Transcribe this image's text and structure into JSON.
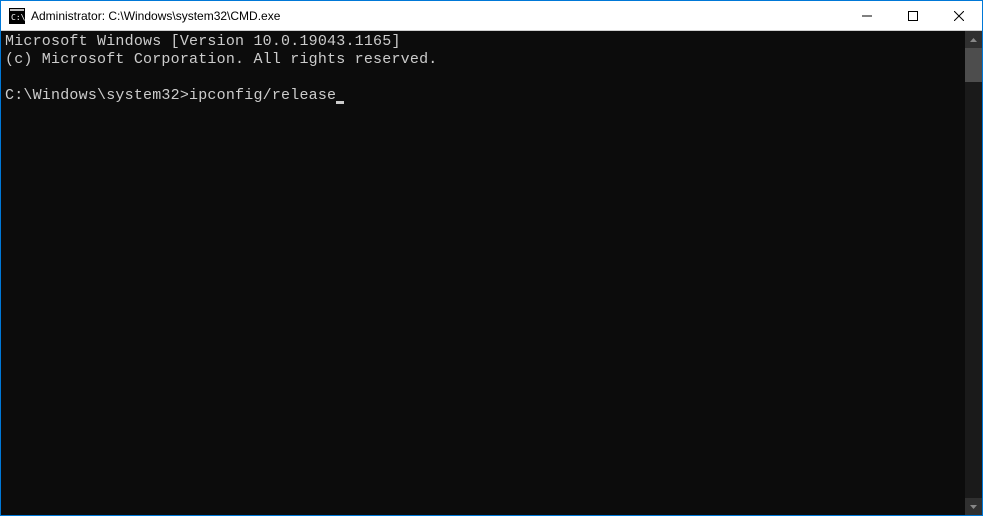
{
  "window": {
    "title": "Administrator: C:\\Windows\\system32\\CMD.exe"
  },
  "terminal": {
    "line1": "Microsoft Windows [Version 10.0.19043.1165]",
    "line2": "(c) Microsoft Corporation. All rights reserved.",
    "prompt": "C:\\Windows\\system32>",
    "command": "ipconfig/release"
  }
}
